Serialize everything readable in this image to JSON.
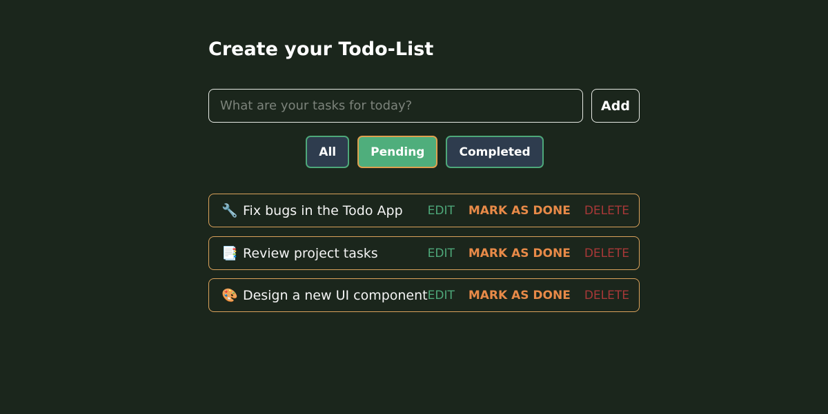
{
  "header": {
    "title": "Create your Todo-List"
  },
  "input": {
    "placeholder": "What are your tasks for today?",
    "value": "",
    "add_label": "Add"
  },
  "filters": [
    {
      "label": "All",
      "active": false
    },
    {
      "label": "Pending",
      "active": true
    },
    {
      "label": "Completed",
      "active": false
    }
  ],
  "tasks": [
    {
      "emoji": "🔧",
      "icon": "wrench-icon",
      "text": "Fix bugs in the Todo App"
    },
    {
      "emoji": "📑",
      "icon": "document-icon",
      "text": "Review project tasks"
    },
    {
      "emoji": "🎨",
      "icon": "palette-icon",
      "text": "Design a new UI component"
    }
  ],
  "actions": {
    "edit": "EDIT",
    "done": "MARK AS DONE",
    "delete": "DELETE"
  },
  "colors": {
    "background": "#1b261c",
    "accent_green": "#4ea87a",
    "accent_orange": "#e88a48",
    "danger": "#a83838",
    "filter_bg": "#2e3c4e"
  }
}
